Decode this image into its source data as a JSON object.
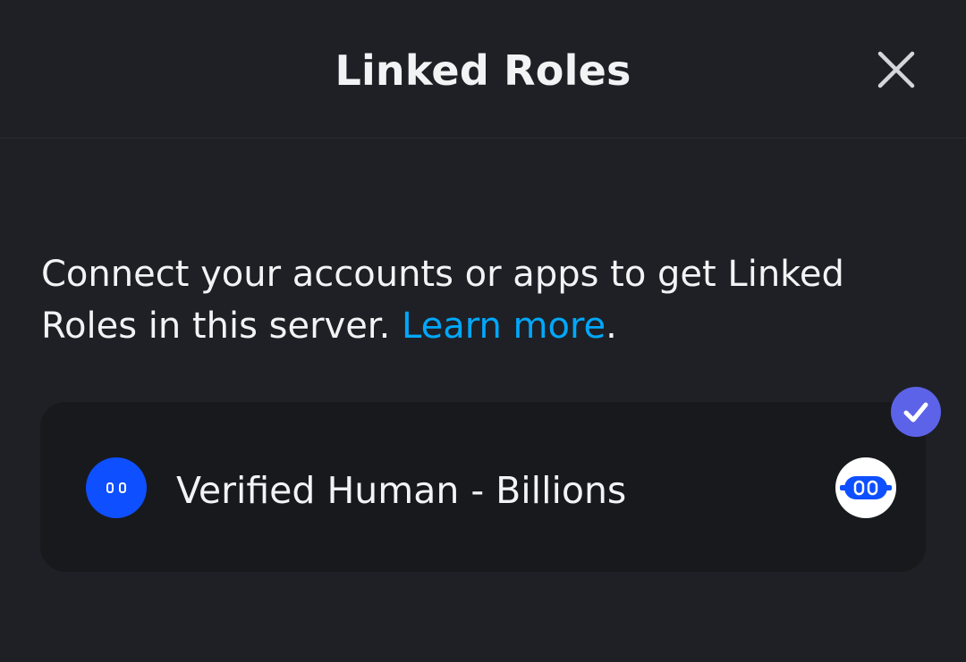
{
  "header": {
    "title": "Linked Roles",
    "close_icon": "close-icon"
  },
  "description": {
    "text": "Connect your accounts or apps to get Linked Roles in this server.",
    "link_text": "Learn more",
    "trailing": "."
  },
  "linked_role": {
    "name": "Verified Human - Billions",
    "app_icon": "billions-logo-icon",
    "connection_icon": "billions-connection-icon",
    "status_icon": "checkmark-icon",
    "verified": true
  },
  "colors": {
    "background": "#1f2025",
    "card": "#18191d",
    "text": "#f2f3f5",
    "link": "#00a8fc",
    "badge": "#5c63e8",
    "app_brand": "#0e4fff"
  }
}
